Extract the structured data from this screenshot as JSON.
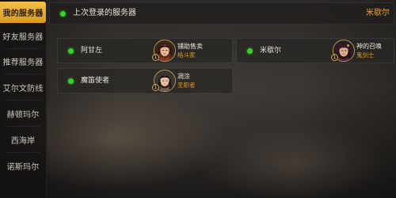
{
  "sidebar": {
    "tabs": [
      {
        "label": "我的服务器",
        "active": true
      },
      {
        "label": "好友服务器",
        "active": false
      },
      {
        "label": "推荐服务器",
        "active": false
      },
      {
        "label": "艾尔文防线",
        "active": false
      },
      {
        "label": "赫顿玛尔",
        "active": false
      },
      {
        "label": "西海岸",
        "active": false
      },
      {
        "label": "诺斯玛尔",
        "active": false
      }
    ]
  },
  "last_login": {
    "title": "上次登录的服务器",
    "server": "米歇尔"
  },
  "servers": [
    {
      "name": "阿甘左",
      "status_color": "#36d12b",
      "character": {
        "name": "铺助售卖",
        "class": "格斗家",
        "avatar": "female-fighter-avatar"
      }
    },
    {
      "name": "米歇尔",
      "status_color": "#36d12b",
      "character": {
        "name": "神的召唤",
        "class": "鬼剑士",
        "avatar": "slayer-avatar"
      }
    },
    {
      "name": "魔笛使者",
      "status_color": "#36d12b",
      "character": {
        "name": "凋涂",
        "class": "圣职者",
        "avatar": "priest-avatar"
      }
    }
  ],
  "colors": {
    "active_tab": "#f2c04a",
    "online_dot": "#36d12b",
    "class_text": "#d19a3c",
    "highlight_server": "#e8a53a"
  }
}
